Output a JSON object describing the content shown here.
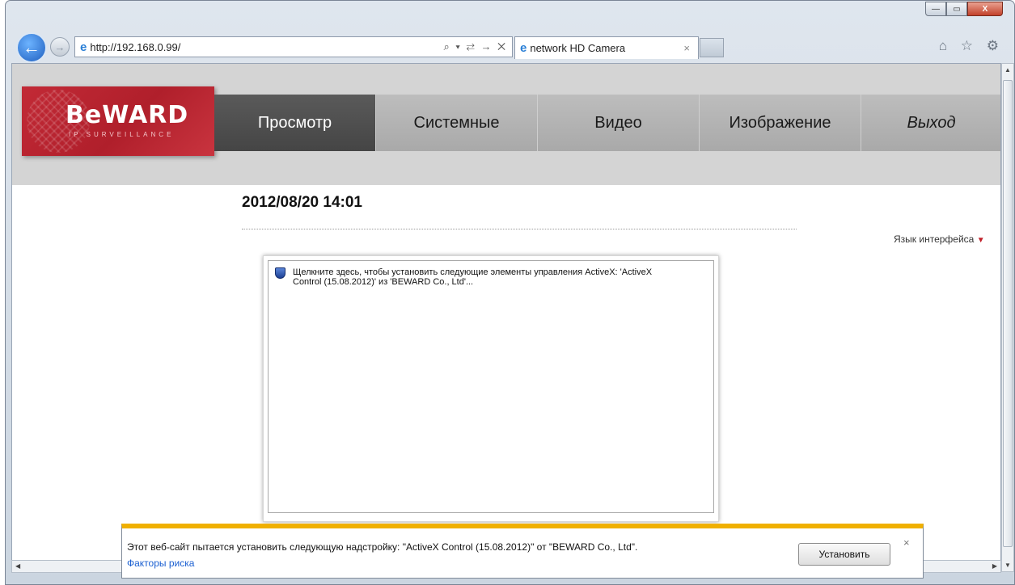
{
  "browser": {
    "url": "http://192.168.0.99/",
    "tab_title": "network HD Camera",
    "tab_close": "×",
    "addr_tools": "⌕ ▾ ⇄ → ✕",
    "toolbar_icons": "⌂ ☆ ⚙",
    "back": "←",
    "forward": "→",
    "win_min": "—",
    "win_max": "▭",
    "win_close": "X"
  },
  "logo": {
    "brand": "BeWARD",
    "tagline": "IP SURVEILLANCE"
  },
  "menu": {
    "items": [
      {
        "label": "Просмотр"
      },
      {
        "label": "Системные"
      },
      {
        "label": "Видео"
      },
      {
        "label": "Изображение"
      },
      {
        "label": "Выход"
      }
    ]
  },
  "page": {
    "datetime": "2012/08/20 14:01",
    "language_label": "Язык интерфейса",
    "language_arrow": "▼"
  },
  "player": {
    "activex_message_line1": "Щелкните здесь, чтобы установить следующие элементы управления ActiveX: 'ActiveX",
    "activex_message_line2": "Control (15.08.2012)' из 'BEWARD Co., Ltd'..."
  },
  "infobar": {
    "message": "Этот веб-сайт пытается установить следующую надстройку: \"ActiveX Control (15.08.2012)\" от \"BEWARD Co., Ltd\".",
    "link": "Факторы риска",
    "install_label": "Установить",
    "close": "×"
  }
}
